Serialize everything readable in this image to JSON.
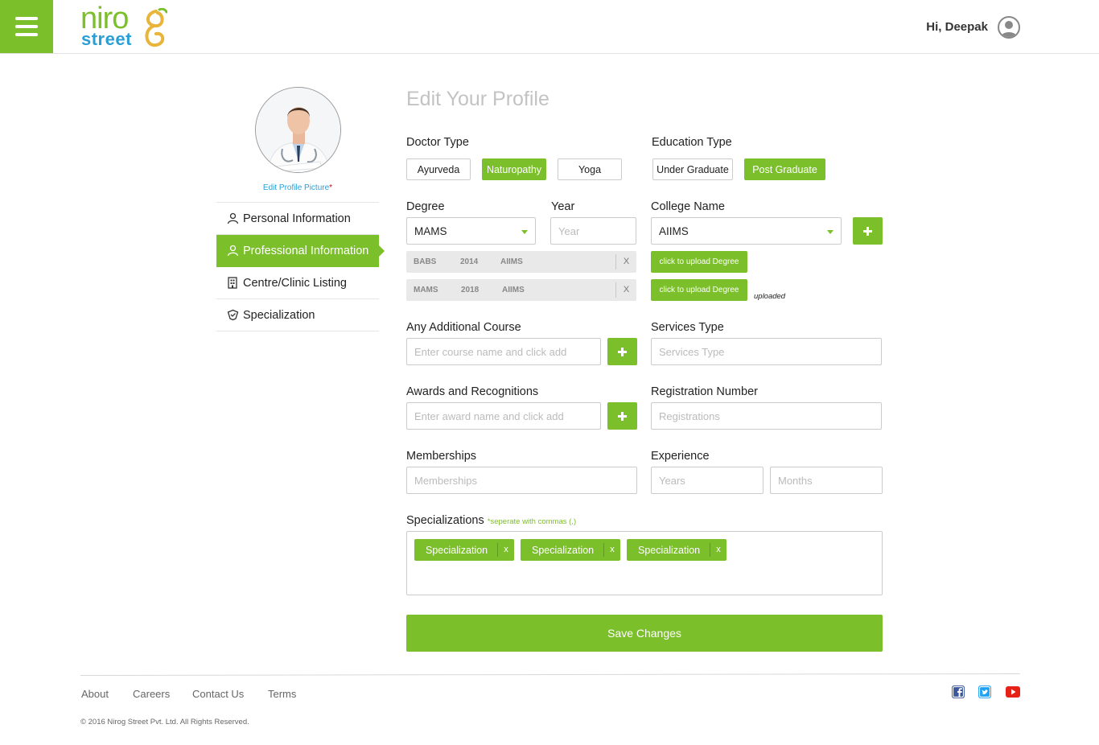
{
  "header": {
    "logo_top": "niro",
    "logo_bottom": "street",
    "greeting": "Hi, Deepak",
    "menu_icon": "hamburger-icon",
    "user_icon": "user-avatar-icon"
  },
  "sidebar": {
    "edit_picture_label": "Edit Profile Picture",
    "required_mark": "*",
    "items": [
      {
        "label": "Personal Information",
        "icon": "person-icon",
        "active": false
      },
      {
        "label": "Professional Information",
        "icon": "person-icon",
        "active": true
      },
      {
        "label": "Centre/Clinic Listing",
        "icon": "building-icon",
        "active": false
      },
      {
        "label": "Specialization",
        "icon": "badge-icon",
        "active": false
      }
    ]
  },
  "main": {
    "title": "Edit Your Profile",
    "doctor_type": {
      "label": "Doctor Type",
      "options": [
        "Ayurveda",
        "Naturopathy",
        "Yoga"
      ],
      "selected": "Naturopathy"
    },
    "education_type": {
      "label": "Education Type",
      "options": [
        "Under Graduate",
        "Post Graduate"
      ],
      "selected": "Post Graduate"
    },
    "degree": {
      "label": "Degree",
      "value": "MAMS"
    },
    "year": {
      "label": "Year",
      "placeholder": "Year"
    },
    "college": {
      "label": "College Name",
      "value": "AIIMS"
    },
    "degree_rows": [
      {
        "degree": "BABS",
        "year": "2014",
        "college": "AIIMS",
        "remove": "X"
      },
      {
        "degree": "MAMS",
        "year": "2018",
        "college": "AIIMS",
        "remove": "X"
      }
    ],
    "upload_buttons": [
      "click to upload Degree",
      "click to upload Degree"
    ],
    "uploaded_note": "uploaded",
    "additional_course": {
      "label": "Any Additional Course",
      "placeholder": "Enter course name and click add"
    },
    "services_type": {
      "label": "Services Type",
      "placeholder": "Services Type"
    },
    "awards": {
      "label": "Awards and Recognitions",
      "placeholder": "Enter award name and click add"
    },
    "registration": {
      "label": "Registration Number",
      "placeholder": "Registrations"
    },
    "memberships": {
      "label": "Memberships",
      "placeholder": "Memberships"
    },
    "experience": {
      "label": "Experience",
      "years_placeholder": "Years",
      "months_placeholder": "Months"
    },
    "specializations": {
      "label": "Specializations",
      "hint": "*seperate with commas (,)",
      "tags": [
        "Specialization",
        "Specialization",
        "Specialization"
      ],
      "remove": "x"
    },
    "save_label": "Save Changes"
  },
  "footer": {
    "links": [
      "About",
      "Careers",
      "Contact Us",
      "Terms"
    ],
    "copyright": "© 2016 Nirog Street Pvt. Ltd. All Rights Reserved.",
    "social": [
      "facebook-icon",
      "twitter-icon",
      "youtube-icon"
    ]
  },
  "colors": {
    "accent": "#7bbf2a",
    "brand_blue": "#2a9fd6",
    "logo_mark": "#e8b53a"
  }
}
